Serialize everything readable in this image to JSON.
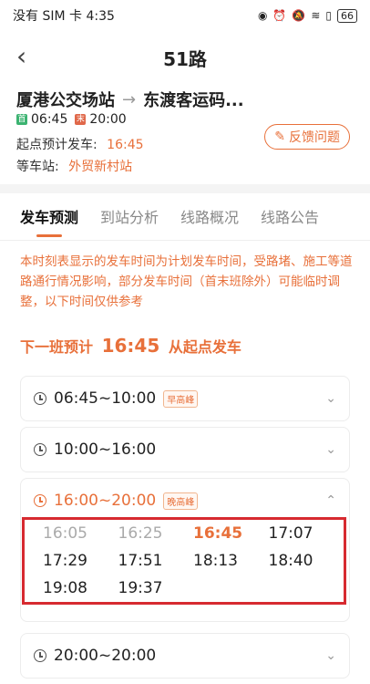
{
  "status_bar": {
    "carrier_time": "没有 SIM 卡 4:35",
    "battery": "66"
  },
  "nav": {
    "title": "51路",
    "back_icon": "chevron-left-icon"
  },
  "route": {
    "from": "厦港公交场站",
    "to": "东渡客运码...",
    "first_bus": "06:45",
    "last_bus": "20:00",
    "first_tag": "首",
    "last_tag": "末"
  },
  "depart": {
    "label": "起点预计发车:",
    "time": "16:45"
  },
  "wait_stop": {
    "label": "等车站:",
    "name": "外贸新村站"
  },
  "feedback": {
    "label": "反馈问题"
  },
  "tabs": [
    "发车预测",
    "到站分析",
    "线路概况",
    "线路公告"
  ],
  "notice": "本时刻表显示的发车时间为计划发车时间，受路堵、施工等道路通行情况影响，部分发车时间（首末班除外）可能临时调整，以下时间仅供参考",
  "next_bus": {
    "prefix": "下一班预计",
    "time": "16:45",
    "suffix": "从起点发车"
  },
  "periods": [
    {
      "range": "06:45~10:00",
      "badge": "早高峰"
    },
    {
      "range": "10:00~16:00",
      "badge": ""
    },
    {
      "range": "16:00~20:00",
      "badge": "晚高峰"
    },
    {
      "range": "20:00~20:00",
      "badge": ""
    }
  ],
  "departures": [
    "16:05",
    "16:25",
    "16:45",
    "17:07",
    "17:29",
    "17:51",
    "18:13",
    "18:40",
    "19:08",
    "19:37"
  ],
  "colors": {
    "accent": "#e8703a",
    "highlight_box": "#d72a30"
  }
}
